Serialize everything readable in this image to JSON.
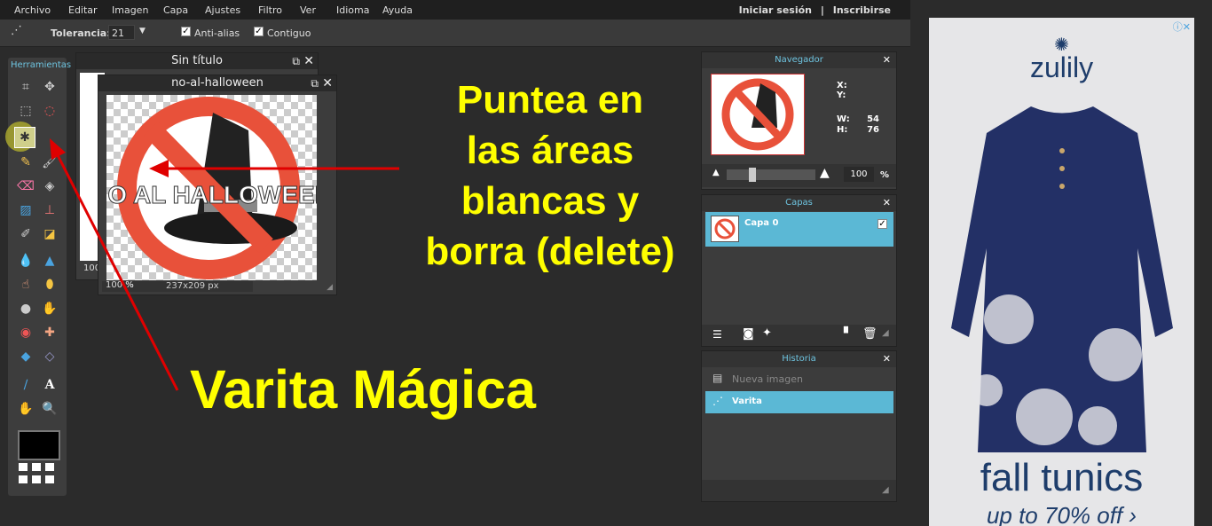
{
  "menu": {
    "items": [
      "Archivo",
      "Editar",
      "Imagen",
      "Capa",
      "Ajustes",
      "Filtro",
      "Ver",
      "Idioma",
      "Ayuda"
    ],
    "login": "Iniciar sesión",
    "sep": "|",
    "register": "Inscribirse"
  },
  "options": {
    "tolerance_label": "Tolerancia:",
    "tolerance_value": "21",
    "antialias_label": "Anti-alias",
    "contiguous_label": "Contiguo"
  },
  "toolbox": {
    "title": "Herramientas"
  },
  "win_back": {
    "title": "Sin título",
    "zoom": "100"
  },
  "win_front": {
    "title": "no-al-halloween",
    "zoom": "100",
    "zoom_unit": "%",
    "size": "237x209 px",
    "image_text": "NO AL HALLOWEEN"
  },
  "navigator": {
    "title": "Navegador",
    "x_label": "X:",
    "y_label": "Y:",
    "w_label": "W:",
    "w_value": "54",
    "h_label": "H:",
    "h_value": "76",
    "zoom": "100",
    "unit": "%"
  },
  "layers": {
    "title": "Capas",
    "layer0": "Capa 0"
  },
  "history": {
    "title": "Historia",
    "items": [
      "Nueva imagen",
      "Varita"
    ]
  },
  "annotations": {
    "top_line1": "Puntea en",
    "top_line2": "las áreas",
    "top_line3": "blancas y",
    "top_line4": "borra (delete)",
    "bottom": "Varita Mágica"
  },
  "ad": {
    "brand": "zulily",
    "headline": "fall tunics",
    "sub": "up to 70% off ›"
  },
  "colors": {
    "accent": "#5bb8d5",
    "annotation": "#ffff00",
    "arrow": "#e00000"
  }
}
